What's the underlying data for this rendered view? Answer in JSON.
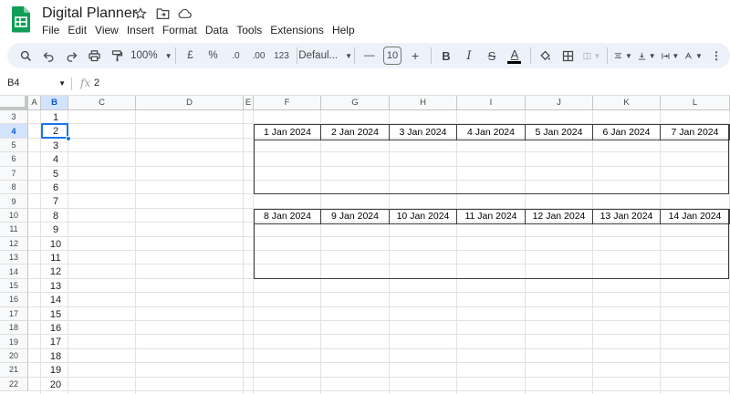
{
  "app": {
    "doc_title": "Digital Planner",
    "brand_color": "#0f9d58",
    "title_icons": [
      "star-icon",
      "move-to-folder-icon",
      "cloud-status-icon"
    ]
  },
  "menu": [
    "File",
    "Edit",
    "View",
    "Insert",
    "Format",
    "Data",
    "Tools",
    "Extensions",
    "Help"
  ],
  "toolbar": {
    "zoom": "100%",
    "currency": "£",
    "percent": "%",
    "decrease_decimals": ".0",
    "increase_decimals": ".00",
    "number_format": "123",
    "font": "Defaul...",
    "font_size": "10",
    "minus": "—",
    "plus": "+",
    "bold": "B",
    "italic": "I",
    "strikethrough": "S",
    "text_color": "A"
  },
  "formula_bar": {
    "cell_ref": "B4",
    "value": "2"
  },
  "sheet": {
    "columns": [
      "A",
      "B",
      "C",
      "D",
      "E",
      "F",
      "G",
      "H",
      "I",
      "J",
      "K",
      "L"
    ],
    "selected_column": "B",
    "rows": [
      "3",
      "4",
      "5",
      "6",
      "7",
      "8",
      "9",
      "10",
      "11",
      "12",
      "13",
      "14",
      "15",
      "16",
      "17",
      "18",
      "19",
      "20",
      "21",
      "22"
    ],
    "selected_row": "4",
    "b_values": [
      "1",
      "2",
      "3",
      "4",
      "5",
      "6",
      "7",
      "8",
      "9",
      "10",
      "11",
      "12",
      "13",
      "14",
      "15",
      "16",
      "17",
      "18",
      "19",
      "20"
    ],
    "week1": [
      "1 Jan 2024",
      "2 Jan 2024",
      "3 Jan 2024",
      "4 Jan 2024",
      "5 Jan 2024",
      "6 Jan 2024",
      "7 Jan 2024"
    ],
    "week2": [
      "8 Jan 2024",
      "9 Jan 2024",
      "10 Jan 2024",
      "11 Jan 2024",
      "12 Jan 2024",
      "13 Jan 2024",
      "14 Jan 2024"
    ],
    "selection_color": "#1a73e8"
  }
}
